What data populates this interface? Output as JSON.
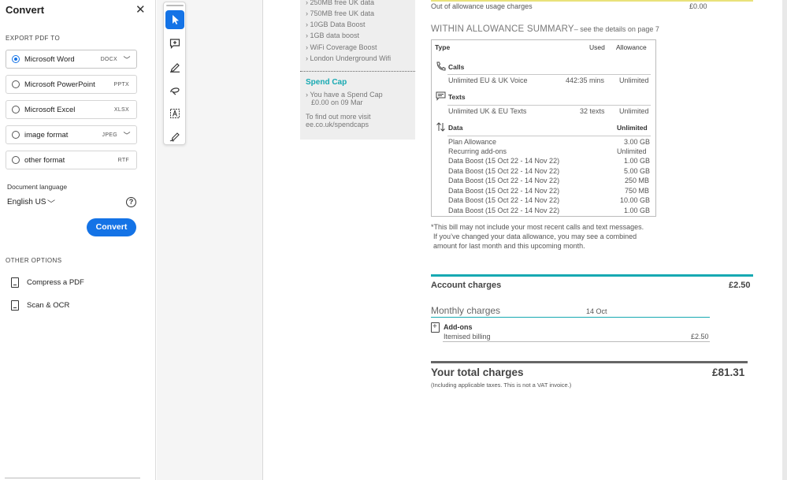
{
  "panel": {
    "title": "Convert",
    "close_icon": "close-icon",
    "export_label": "EXPORT PDF TO",
    "formats": [
      {
        "name": "Microsoft Word",
        "ext": "DOCX",
        "selected": true,
        "has_dropdown": true
      },
      {
        "name": "Microsoft PowerPoint",
        "ext": "PPTX",
        "selected": false,
        "has_dropdown": false
      },
      {
        "name": "Microsoft Excel",
        "ext": "XLSX",
        "selected": false,
        "has_dropdown": false
      },
      {
        "name": "image format",
        "ext": "JPEG",
        "selected": false,
        "has_dropdown": true
      },
      {
        "name": "other format",
        "ext": "RTF",
        "selected": false,
        "has_dropdown": false
      }
    ],
    "language_label": "Document language",
    "language_value": "English US",
    "convert_button": "Convert",
    "other_options_label": "OTHER OPTIONS",
    "other_options": [
      {
        "label": "Compress a PDF",
        "icon": "compress-pdf-icon"
      },
      {
        "label": "Scan & OCR",
        "icon": "scan-ocr-icon"
      }
    ]
  },
  "tools": [
    {
      "name": "select-tool",
      "icon": "cursor-arrow-icon",
      "active": true
    },
    {
      "name": "comment-tool",
      "icon": "add-comment-icon",
      "active": false
    },
    {
      "name": "highlight-tool",
      "icon": "highlighter-pen-icon",
      "active": false
    },
    {
      "name": "draw-tool",
      "icon": "freehand-loop-icon",
      "active": false
    },
    {
      "name": "text-tool",
      "icon": "text-box-icon",
      "active": false
    },
    {
      "name": "sign-tool",
      "icon": "signature-pen-icon",
      "active": false
    }
  ],
  "sidebox": {
    "items": [
      "250MB free UK data",
      "750MB free UK data",
      "10GB Data Boost",
      "1GB data boost",
      "WiFi Coverage Boost",
      "London Underground Wifi"
    ],
    "spend_cap_title": "Spend Cap",
    "spend_cap_line1": "You have a Spend Cap",
    "spend_cap_line2": "£0.00 on 09 Mar",
    "find_out_line1": "To find out more visit",
    "find_out_line2": "ee.co.uk/spendcaps"
  },
  "document": {
    "out_of_allowance_label": "Out of allowance usage charges",
    "out_of_allowance_value": "£0.00",
    "summary_title": "WITHIN ALLOWANCE SUMMARY",
    "summary_note": "– see the details on page 7",
    "table_headers": {
      "type": "Type",
      "used": "Used",
      "allowance": "Allowance"
    },
    "calls": {
      "title": "Calls",
      "row": {
        "label": "Unlimited EU & UK Voice",
        "used": "442:35 mins",
        "allowance": "Unlimited"
      }
    },
    "texts": {
      "title": "Texts",
      "row": {
        "label": "Unlimited UK & EU Texts",
        "used": "32 texts",
        "allowance": "Unlimited"
      }
    },
    "data": {
      "title": "Data",
      "total": "Unlimited",
      "rows": [
        {
          "label": "Plan Allowance",
          "value": "3.00 GB"
        },
        {
          "label": "Recurring add-ons",
          "value": "Unlimited"
        },
        {
          "label": "Data Boost (15 Oct 22 - 14 Nov 22)",
          "value": "1.00 GB"
        },
        {
          "label": "Data Boost (15 Oct 22 - 14 Nov 22)",
          "value": "5.00 GB"
        },
        {
          "label": "Data Boost (15 Oct 22 - 14 Nov 22)",
          "value": "250 MB"
        },
        {
          "label": "Data Boost (15 Oct 22 - 14 Nov 22)",
          "value": "750 MB"
        },
        {
          "label": "Data Boost (15 Oct 22 - 14 Nov 22)",
          "value": "10.00 GB"
        },
        {
          "label": "Data Boost (15 Oct 22 - 14 Nov 22)",
          "value": "1.00 GB"
        }
      ]
    },
    "footnote": [
      "*This bill may not include your most recent calls and text messages.",
      "If you’ve changed your data allowance, you may see a combined",
      "amount for last month and this upcoming month."
    ],
    "account_charges_label": "Account charges",
    "account_charges_value": "£2.50",
    "monthly_charges_label": "Monthly charges",
    "monthly_charges_date": "14 Oct",
    "addons_label": "Add-ons",
    "itemised_label": "Itemised billing",
    "itemised_value": "£2.50",
    "total_label": "Your total charges",
    "total_value": "£81.31",
    "total_note": "(Including applicable taxes. This is not a VAT invoice.)"
  },
  "colors": {
    "accent": "#1473e6",
    "teal": "#17a9b2",
    "yellow": "#e9e27a"
  }
}
